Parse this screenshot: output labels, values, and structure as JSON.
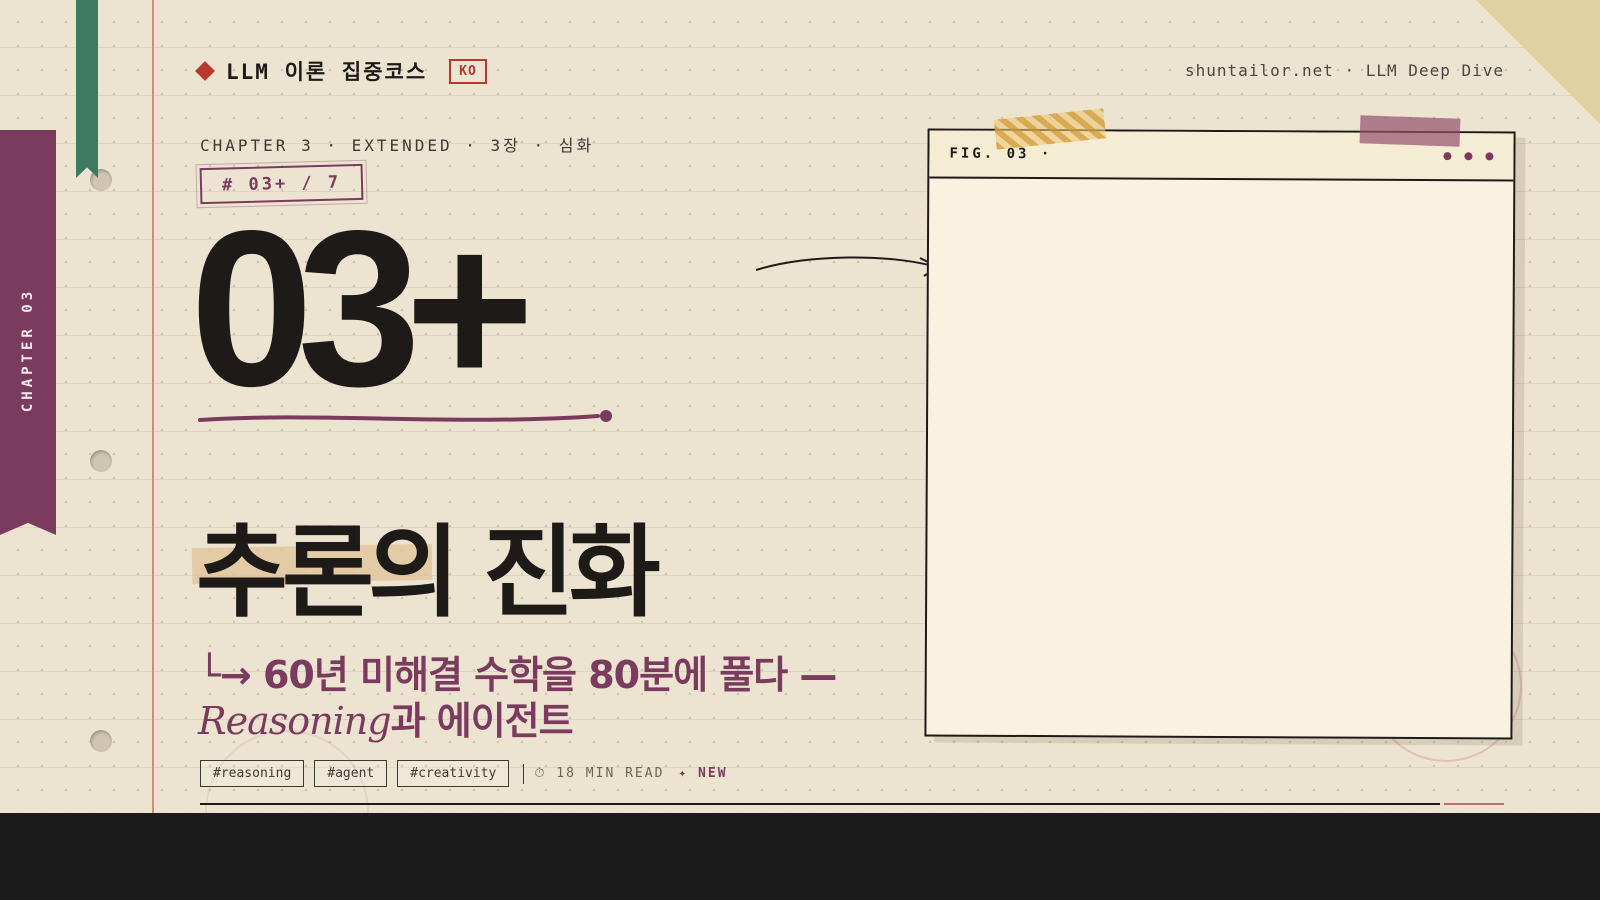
{
  "brand": {
    "title": "LLM 이론 집중코스",
    "lang": "KO"
  },
  "site": "shuntailor.net · LLM Deep Dive",
  "sidebar": {
    "chapter_tab": "CHAPTER 03"
  },
  "chapter": {
    "label": "CHAPTER 3 · EXTENDED  ·  3장 · 심화",
    "stamp": "# 03+ / 7",
    "number": "03+"
  },
  "title": "추론의 진화",
  "subtitle": {
    "arrow": "└→ ",
    "part1": "60년 미해결 수학을 80분에 풀다 — ",
    "latin": "Reasoning",
    "part2": "과 에이전트"
  },
  "tags": [
    "#reasoning",
    "#agent",
    "#creativity"
  ],
  "meta": {
    "read_time": "⏱ 18 MIN READ",
    "new_label": "✦ NEW"
  },
  "figure": {
    "label": "FIG. 03 ·"
  },
  "colors": {
    "accent": "#7b3b5f",
    "red": "#b8382e",
    "green": "#3e7a62",
    "paper": "#ece4d1",
    "ink": "#1d1a17"
  }
}
